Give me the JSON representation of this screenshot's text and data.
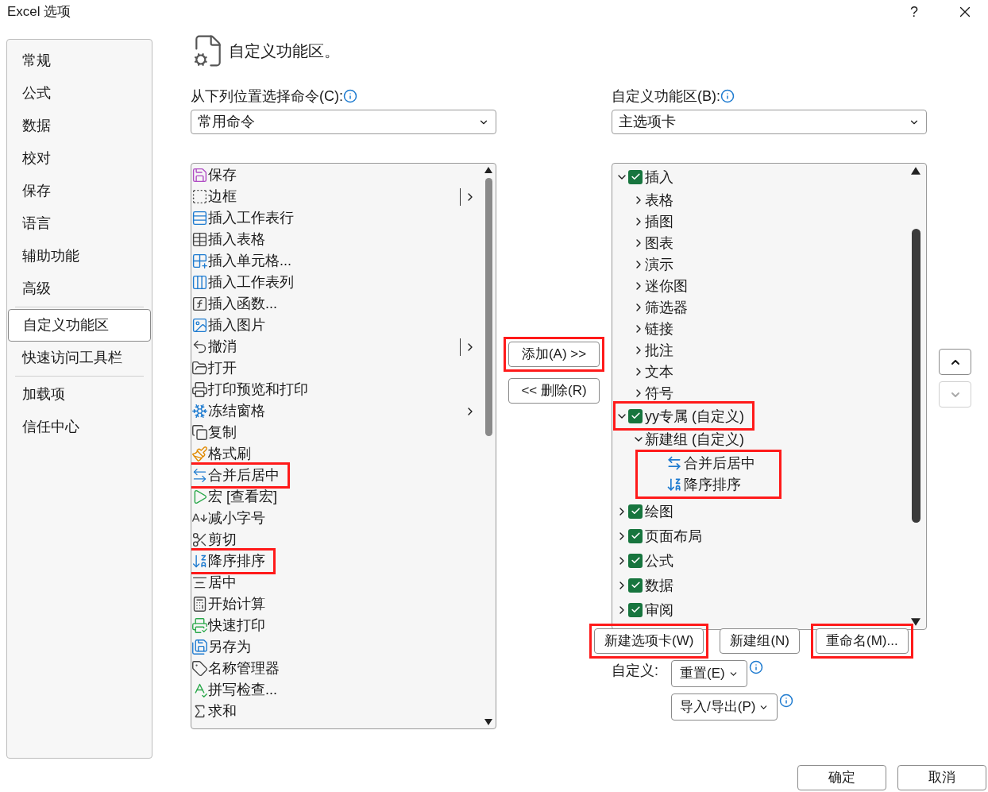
{
  "window": {
    "title": "Excel 选项",
    "help": "?"
  },
  "sidebar": {
    "items": [
      {
        "label": "常规",
        "selected": false
      },
      {
        "label": "公式",
        "selected": false
      },
      {
        "label": "数据",
        "selected": false
      },
      {
        "label": "校对",
        "selected": false
      },
      {
        "label": "保存",
        "selected": false
      },
      {
        "label": "语言",
        "selected": false
      },
      {
        "label": "辅助功能",
        "selected": false
      },
      {
        "label": "高级",
        "selected": false,
        "divider_after": true
      },
      {
        "label": "自定义功能区",
        "selected": true
      },
      {
        "label": "快速访问工具栏",
        "selected": false,
        "divider_after": true
      },
      {
        "label": "加载项",
        "selected": false
      },
      {
        "label": "信任中心",
        "selected": false
      }
    ]
  },
  "header": {
    "title": "自定义功能区。"
  },
  "commands_source": {
    "label": "从下列位置选择命令(C):",
    "value": "常用命令"
  },
  "ribbon_target": {
    "label": "自定义功能区(B):",
    "value": "主选项卡"
  },
  "command_list": [
    {
      "label": "保存",
      "kind": "plain",
      "highlighted": false
    },
    {
      "label": "边框",
      "kind": "split",
      "highlighted": false
    },
    {
      "label": "插入工作表行",
      "kind": "plain",
      "highlighted": false
    },
    {
      "label": "插入表格",
      "kind": "plain",
      "highlighted": false
    },
    {
      "label": "插入单元格...",
      "kind": "plain",
      "highlighted": false
    },
    {
      "label": "插入工作表列",
      "kind": "plain",
      "highlighted": false
    },
    {
      "label": "插入函数...",
      "kind": "plain",
      "highlighted": false
    },
    {
      "label": "插入图片",
      "kind": "plain",
      "highlighted": false
    },
    {
      "label": "撤消",
      "kind": "split",
      "highlighted": false
    },
    {
      "label": "打开",
      "kind": "plain",
      "highlighted": false
    },
    {
      "label": "打印预览和打印",
      "kind": "plain",
      "highlighted": false
    },
    {
      "label": "冻结窗格",
      "kind": "arrow",
      "highlighted": false
    },
    {
      "label": "复制",
      "kind": "plain",
      "highlighted": false
    },
    {
      "label": "格式刷",
      "kind": "plain",
      "highlighted": false
    },
    {
      "label": "合并后居中",
      "kind": "plain",
      "highlighted": true
    },
    {
      "label": "宏 [查看宏]",
      "kind": "plain",
      "highlighted": false
    },
    {
      "label": "减小字号",
      "kind": "plain",
      "highlighted": false
    },
    {
      "label": "剪切",
      "kind": "plain",
      "highlighted": false
    },
    {
      "label": "降序排序",
      "kind": "plain",
      "highlighted": true
    },
    {
      "label": "居中",
      "kind": "plain",
      "highlighted": false
    },
    {
      "label": "开始计算",
      "kind": "plain",
      "highlighted": false
    },
    {
      "label": "快速打印",
      "kind": "plain",
      "highlighted": false
    },
    {
      "label": "另存为",
      "kind": "plain",
      "highlighted": false
    },
    {
      "label": "名称管理器",
      "kind": "plain",
      "highlighted": false
    },
    {
      "label": "拼写检查...",
      "kind": "plain",
      "highlighted": false
    },
    {
      "label": "求和",
      "kind": "plain",
      "highlighted": false
    }
  ],
  "transfer_buttons": [
    {
      "label": "添加(A) >>",
      "highlighted": true
    },
    {
      "label": "<< 删除(R)",
      "highlighted": false
    }
  ],
  "ribbon_tree": [
    {
      "kind": "tab",
      "label": "插入",
      "checked": true,
      "expanded": true,
      "highlighted": false,
      "children": [
        {
          "kind": "group",
          "label": "表格",
          "expanded": false
        },
        {
          "kind": "group",
          "label": "插图",
          "expanded": false
        },
        {
          "kind": "group",
          "label": "图表",
          "expanded": false
        },
        {
          "kind": "group",
          "label": "演示",
          "expanded": false
        },
        {
          "kind": "group",
          "label": "迷你图",
          "expanded": false
        },
        {
          "kind": "group",
          "label": "筛选器",
          "expanded": false
        },
        {
          "kind": "group",
          "label": "链接",
          "expanded": false
        },
        {
          "kind": "group",
          "label": "批注",
          "expanded": false
        },
        {
          "kind": "group",
          "label": "文本",
          "expanded": false
        },
        {
          "kind": "group",
          "label": "符号",
          "expanded": false
        }
      ]
    },
    {
      "kind": "tab",
      "label": "yy专属 (自定义)",
      "checked": true,
      "expanded": true,
      "highlighted": true,
      "children": [
        {
          "kind": "group",
          "label": "新建组 (自定义)",
          "expanded": true,
          "highlight_children": true,
          "children": [
            {
              "kind": "command",
              "label": "合并后居中"
            },
            {
              "kind": "command",
              "label": "降序排序"
            }
          ]
        }
      ]
    },
    {
      "kind": "tab",
      "label": "绘图",
      "checked": true,
      "expanded": false,
      "highlighted": false
    },
    {
      "kind": "tab",
      "label": "页面布局",
      "checked": true,
      "expanded": false,
      "highlighted": false
    },
    {
      "kind": "tab",
      "label": "公式",
      "checked": true,
      "expanded": false,
      "highlighted": false
    },
    {
      "kind": "tab",
      "label": "数据",
      "checked": true,
      "expanded": false,
      "highlighted": false
    },
    {
      "kind": "tab",
      "label": "审阅",
      "checked": true,
      "expanded": false,
      "highlighted": false
    }
  ],
  "tree_buttons": [
    {
      "label": "新建选项卡(W)",
      "highlighted": true
    },
    {
      "label": "新建组(N)",
      "highlighted": false
    },
    {
      "label": "重命名(M)...",
      "highlighted": true
    }
  ],
  "customize": {
    "label": "自定义:",
    "buttons": [
      {
        "label": "重置(E)"
      },
      {
        "label": "导入/导出(P)"
      }
    ]
  },
  "footer_buttons": [
    "确定",
    "取消"
  ]
}
